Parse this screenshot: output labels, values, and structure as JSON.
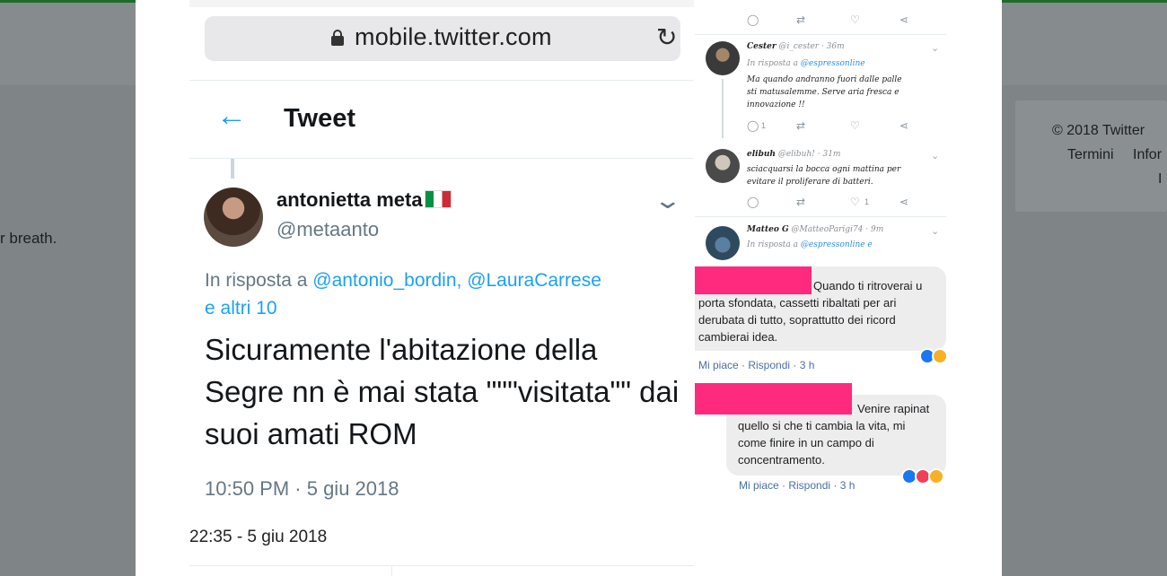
{
  "background": {
    "left_text": "r breath.",
    "copyright": "© 2018 Twitter",
    "links": [
      "Termini",
      "Infor"
    ],
    "trailing": "I"
  },
  "phone": {
    "url": "mobile.twitter.com",
    "header_title": "Tweet",
    "tweet": {
      "author_name": "antonietta meta",
      "author_handle": "@metaanto",
      "reply_prefix": "In risposta a",
      "reply_mentions": "@antonio_bordin, @LauraCarrese",
      "reply_others": "e altri 10",
      "text": "Sicuramente l'abitazione della Segre nn è mai stata \"\"\"visitata\"\" dai suoi amati ROM",
      "time": "10:50 PM · 5 giu 2018"
    },
    "photo_timestamp": "22:35 - 5 giu 2018"
  },
  "collage": {
    "comments": [
      {
        "name": "Cester",
        "handle": "@i_cester · 36m",
        "reply_prefix": "In risposta a",
        "reply_to": "@espressonline",
        "text_lines": [
          "Ma quando andranno fuori dalle palle",
          "sti matusalemme. Serve aria fresca e",
          "innovazione !!"
        ],
        "reply_count": "1",
        "like_count": ""
      },
      {
        "name": "elibuh",
        "handle": "@elibuh! · 31m",
        "reply_prefix": "",
        "reply_to": "",
        "text_lines": [
          "sciacquarsi la bocca ogni mattina per",
          "evitare il proliferare di batteri."
        ],
        "reply_count": "",
        "like_count": "1"
      },
      {
        "name": "Matteo G",
        "handle": "@MatteoParigi74 · 9m",
        "reply_prefix": "In risposta a",
        "reply_to": "@espressonline e",
        "text_lines": [],
        "reply_count": "",
        "like_count": ""
      }
    ],
    "facebook": [
      {
        "lines": [
          "Quando ti ritroverai u",
          "porta sfondata, cassetti ribaltati per ari",
          "derubata di tutto, soprattutto dei ricord",
          "cambierai idea."
        ],
        "meta": "Mi piace · Rispondi · 3 h"
      },
      {
        "lines": [
          "Venire rapinat",
          "quello si che ti cambia la vita, mi",
          "come finire in un campo di",
          "concentramento."
        ],
        "meta": "Mi piace · Rispondi · 3 h"
      }
    ]
  },
  "colors": {
    "twitter_blue": "#1da1f2",
    "redaction": "#ff2a7d"
  }
}
